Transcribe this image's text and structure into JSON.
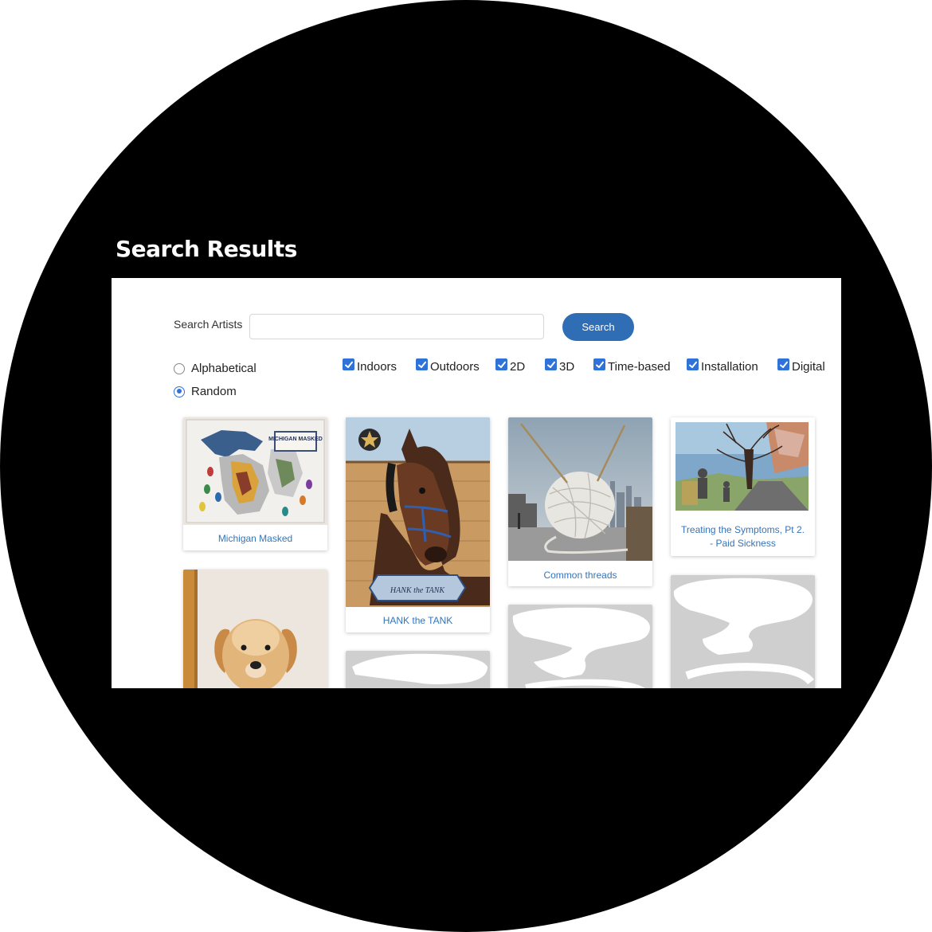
{
  "page": {
    "title": "Search Results"
  },
  "search": {
    "label": "Search Artists",
    "value": "",
    "placeholder": "",
    "button_label": "Search"
  },
  "sort": {
    "options": [
      {
        "label": "Alphabetical",
        "selected": false
      },
      {
        "label": "Random",
        "selected": true
      }
    ]
  },
  "filters": [
    {
      "label": "Indoors",
      "checked": true
    },
    {
      "label": "Outdoors",
      "checked": true
    },
    {
      "label": "2D",
      "checked": true
    },
    {
      "label": "3D",
      "checked": true
    },
    {
      "label": "Time-based",
      "checked": true
    },
    {
      "label": "Installation",
      "checked": true
    },
    {
      "label": "Digital",
      "checked": true
    }
  ],
  "results": [
    {
      "title": "Michigan Masked"
    },
    {
      "title": "HANK the TANK"
    },
    {
      "title": "Common threads"
    },
    {
      "title": "Treating the Symptoms, Pt 2. - Paid Sickness"
    }
  ],
  "artwork_text": {
    "michigan_sign": "MICHIGAN MASKED",
    "hank_banner": "HANK the TANK"
  },
  "colors": {
    "accent": "#2f6db5",
    "link": "#3574b8",
    "checkbox": "#2f73d9",
    "placeholder": "#cfcfcf"
  }
}
